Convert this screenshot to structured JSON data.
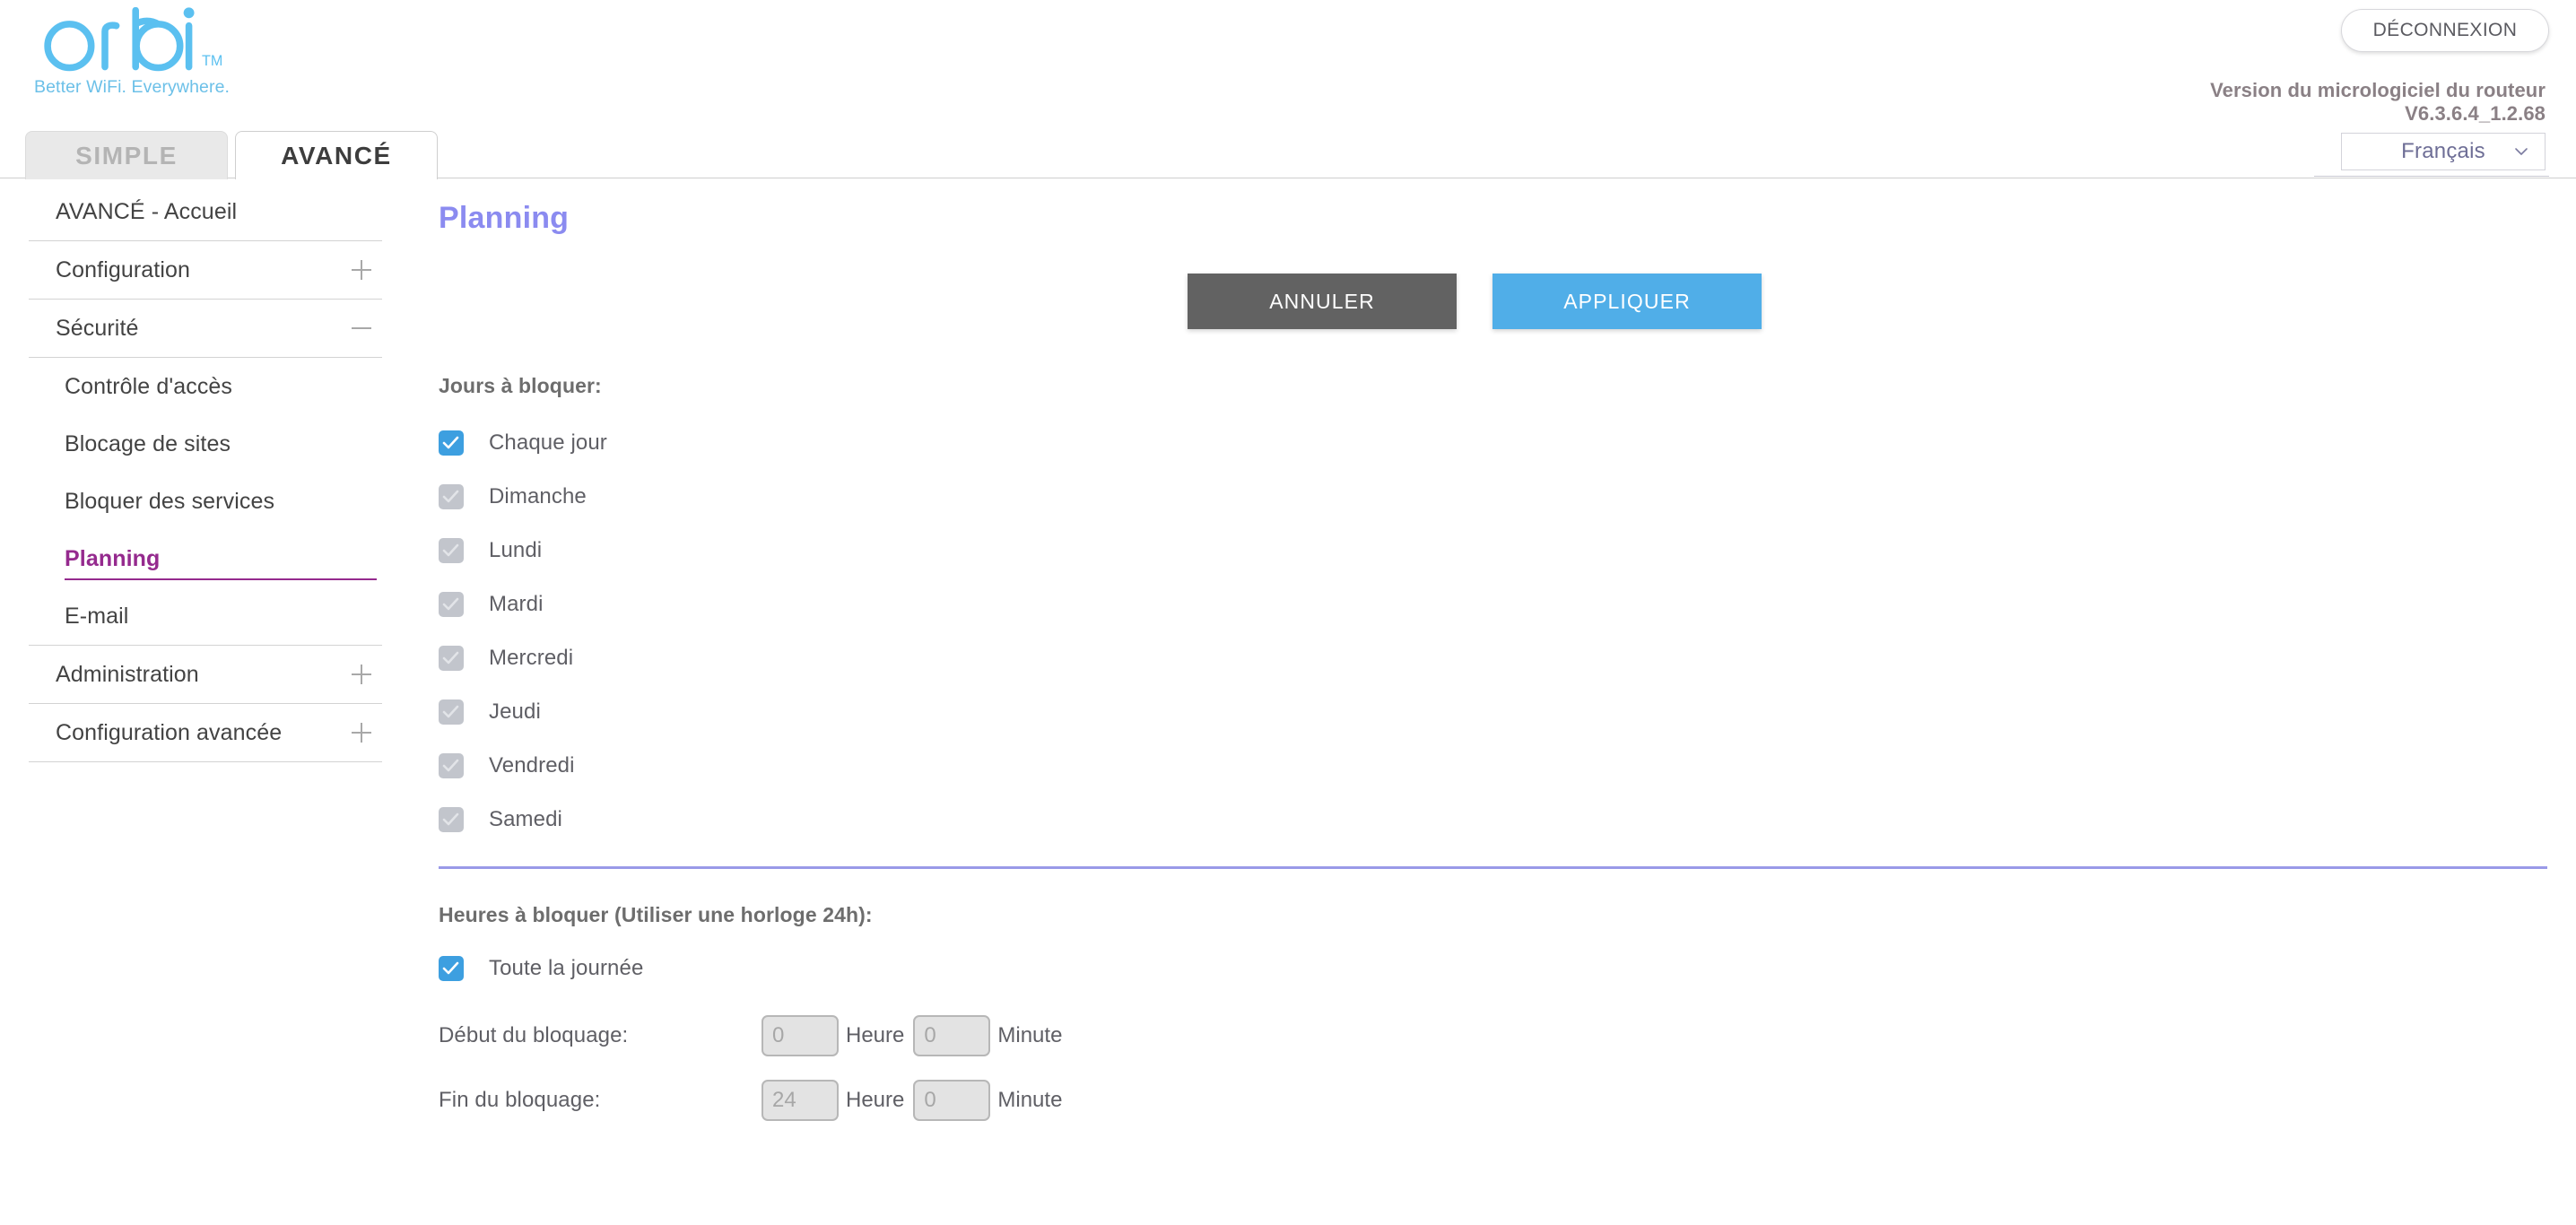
{
  "brand": {
    "name": "orbi",
    "trademark": "TM",
    "tagline": "Better WiFi. Everywhere.",
    "logo_color": "#5bc0f0"
  },
  "header": {
    "logout_label": "DÉCONNEXION",
    "firmware_title": "Version du micrologiciel du routeur",
    "firmware_version": "V6.3.6.4_1.2.68",
    "language_selected": "Français",
    "chevron_icon": "chevron-down-icon"
  },
  "tabs": [
    {
      "label": "SIMPLE",
      "active": false
    },
    {
      "label": "AVANCÉ",
      "active": true
    }
  ],
  "sidebar": {
    "items": [
      {
        "label": "AVANCÉ - Accueil",
        "type": "link",
        "toggle": "none",
        "active": false
      },
      {
        "label": "Configuration",
        "type": "group",
        "toggle": "plus",
        "active": false
      },
      {
        "label": "Sécurité",
        "type": "group",
        "toggle": "minus",
        "active": false
      },
      {
        "label": "Contrôle d'accès",
        "type": "sub",
        "toggle": "none",
        "active": false
      },
      {
        "label": "Blocage de sites",
        "type": "sub",
        "toggle": "none",
        "active": false
      },
      {
        "label": "Bloquer des services",
        "type": "sub",
        "toggle": "none",
        "active": false
      },
      {
        "label": "Planning",
        "type": "sub",
        "toggle": "none",
        "active": true
      },
      {
        "label": "E-mail",
        "type": "sub",
        "toggle": "none",
        "active": false
      },
      {
        "label": "Administration",
        "type": "group",
        "toggle": "plus",
        "active": false
      },
      {
        "label": "Configuration avancée",
        "type": "group",
        "toggle": "plus",
        "active": false
      }
    ],
    "active_color": "#952a8e"
  },
  "main": {
    "page_title": "Planning",
    "title_color": "#8b8bf0",
    "buttons": {
      "cancel_label": "ANNULER",
      "apply_label": "APPLIQUER",
      "cancel_color": "#626262",
      "apply_color": "#50aee8"
    },
    "days_section": {
      "legend": "Jours à bloquer:",
      "items": [
        {
          "label": "Chaque jour",
          "checked": true,
          "enabled": true
        },
        {
          "label": "Dimanche",
          "checked": true,
          "enabled": false
        },
        {
          "label": "Lundi",
          "checked": true,
          "enabled": false
        },
        {
          "label": "Mardi",
          "checked": true,
          "enabled": false
        },
        {
          "label": "Mercredi",
          "checked": true,
          "enabled": false
        },
        {
          "label": "Jeudi",
          "checked": true,
          "enabled": false
        },
        {
          "label": "Vendredi",
          "checked": true,
          "enabled": false
        },
        {
          "label": "Samedi",
          "checked": true,
          "enabled": false
        }
      ]
    },
    "divider_color": "#9a9ae8",
    "hours_section": {
      "legend": "Heures à bloquer (Utiliser une horloge 24h):",
      "all_day": {
        "label": "Toute la journée",
        "checked": true,
        "enabled": true
      },
      "start": {
        "label": "Début du bloquage:",
        "hour_value": "0",
        "hour_unit": "Heure",
        "minute_value": "0",
        "minute_unit": "Minute"
      },
      "end": {
        "label": "Fin du bloquage:",
        "hour_value": "24",
        "hour_unit": "Heure",
        "minute_value": "0",
        "minute_unit": "Minute"
      }
    }
  }
}
